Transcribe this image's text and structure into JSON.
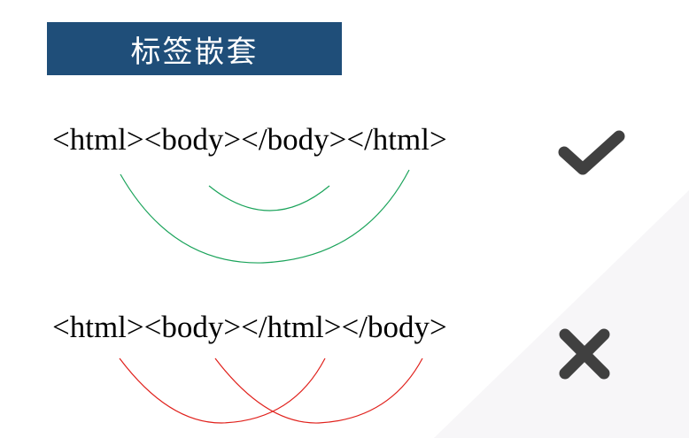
{
  "slide": {
    "title": "标签嵌套",
    "examples": [
      {
        "code": "<html><body></body></html>",
        "result_icon": "check-icon",
        "arc_color": "#1aa35a"
      },
      {
        "code": "<html><body></html></body>",
        "result_icon": "cross-icon",
        "arc_color": "#e0201b"
      }
    ]
  },
  "colors": {
    "title_background": "#1f4e79",
    "title_text": "#ffffff",
    "mark_color": "#404040"
  }
}
